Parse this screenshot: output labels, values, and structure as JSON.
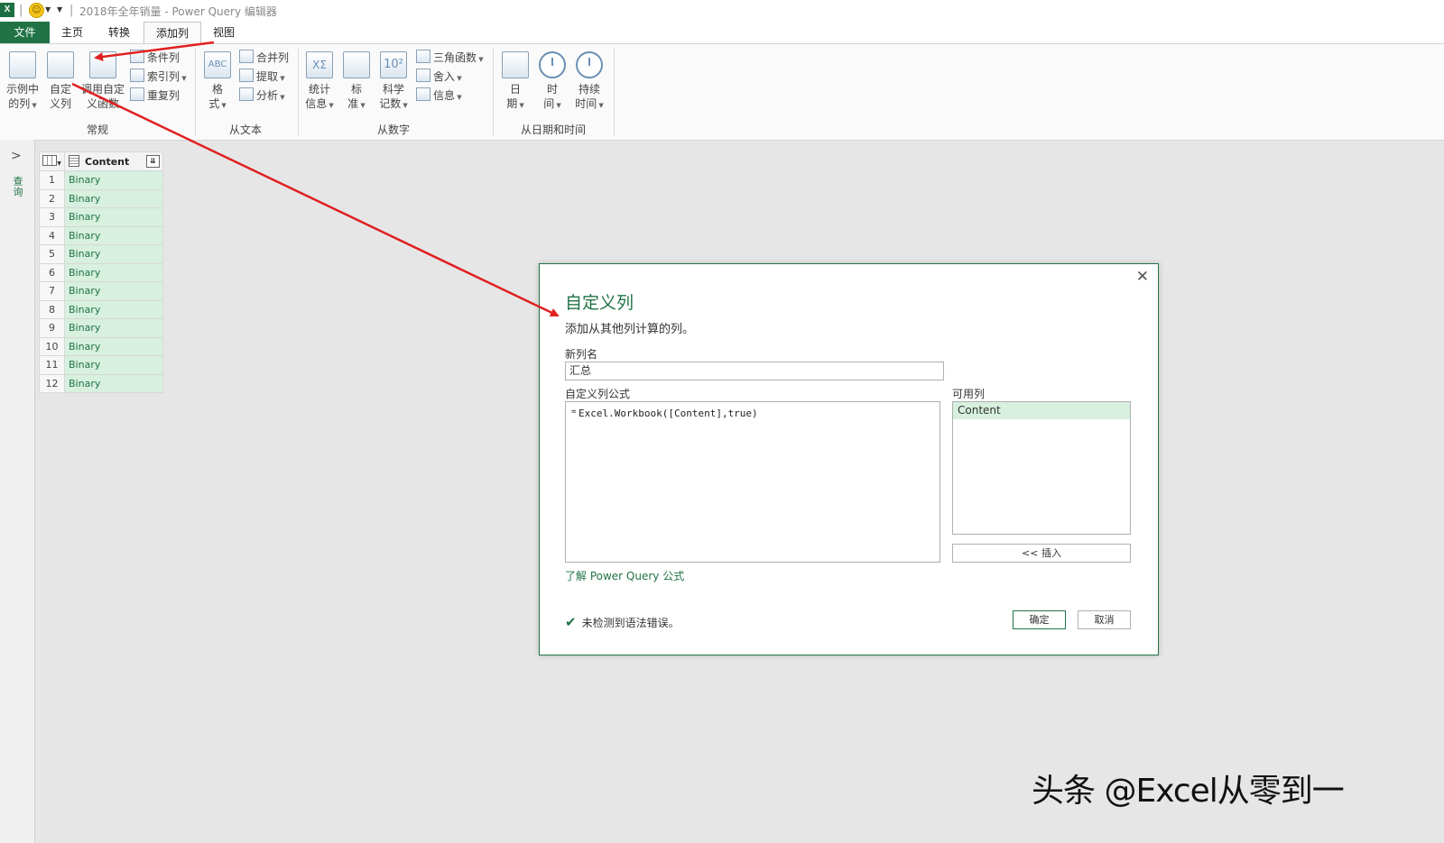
{
  "window": {
    "app_icon_label": "X",
    "title": "2018年全年销量 - Power Query 编辑器"
  },
  "menu": {
    "tabs": [
      {
        "label": "文件"
      },
      {
        "label": "主页"
      },
      {
        "label": "转换"
      },
      {
        "label": "添加列"
      },
      {
        "label": "视图"
      }
    ],
    "active_tab": "添加列"
  },
  "ribbon": {
    "general": {
      "label": "常规",
      "example_column": {
        "line1": "示例中",
        "line2": "的列"
      },
      "custom_column": {
        "line1": "自定",
        "line2": "义列"
      },
      "invoke_custom_function": {
        "line1": "调用自定",
        "line2": "义函数"
      },
      "conditional_column": "条件列",
      "index_column": "索引列",
      "duplicate_column": "重复列"
    },
    "from_text": {
      "label": "从文本",
      "format": {
        "line1": "格",
        "line2": "式"
      },
      "merge_columns": "合并列",
      "extract": "提取",
      "parse": "分析",
      "abc_glyph": "ABC"
    },
    "from_number": {
      "label": "从数字",
      "statistics": {
        "line1": "统计",
        "line2": "信息"
      },
      "standard": {
        "line1": "标",
        "line2": "准"
      },
      "scientific": {
        "line1": "科学",
        "line2": "记数"
      },
      "trigonometry": "三角函数",
      "rounding": "舍入",
      "information": "信息",
      "stats_glyph": "XΣ",
      "sci_glyph": "10²"
    },
    "from_datetime": {
      "label": "从日期和时间",
      "date": {
        "line1": "日",
        "line2": "期"
      },
      "time": {
        "line1": "时",
        "line2": "间"
      },
      "duration": {
        "line1": "持续",
        "line2": "时间"
      }
    }
  },
  "left_pane": {
    "label": "查询"
  },
  "table": {
    "column_header": "Content",
    "rows": [
      {
        "n": "1",
        "value": "Binary"
      },
      {
        "n": "2",
        "value": "Binary"
      },
      {
        "n": "3",
        "value": "Binary"
      },
      {
        "n": "4",
        "value": "Binary"
      },
      {
        "n": "5",
        "value": "Binary"
      },
      {
        "n": "6",
        "value": "Binary"
      },
      {
        "n": "7",
        "value": "Binary"
      },
      {
        "n": "8",
        "value": "Binary"
      },
      {
        "n": "9",
        "value": "Binary"
      },
      {
        "n": "10",
        "value": "Binary"
      },
      {
        "n": "11",
        "value": "Binary"
      },
      {
        "n": "12",
        "value": "Binary"
      }
    ]
  },
  "dialog": {
    "title": "自定义列",
    "subtitle": "添加从其他列计算的列。",
    "new_column_name_label": "新列名",
    "new_column_name_value": "汇总",
    "formula_label": "自定义列公式",
    "formula_prefix": "=",
    "formula_value": "Excel.Workbook([Content],true)",
    "available_columns_label": "可用列",
    "available_columns": [
      "Content"
    ],
    "insert_button": "<< 插入",
    "learn_link": "了解 Power Query 公式",
    "status_text": "未检测到语法错误。",
    "ok_button": "确定",
    "cancel_button": "取消",
    "close_glyph": "✕"
  },
  "watermark": "头条 @Excel从零到一",
  "colors": {
    "accent": "#217346",
    "arrow": "#e02020",
    "row_highlight": "#d7f0df"
  }
}
